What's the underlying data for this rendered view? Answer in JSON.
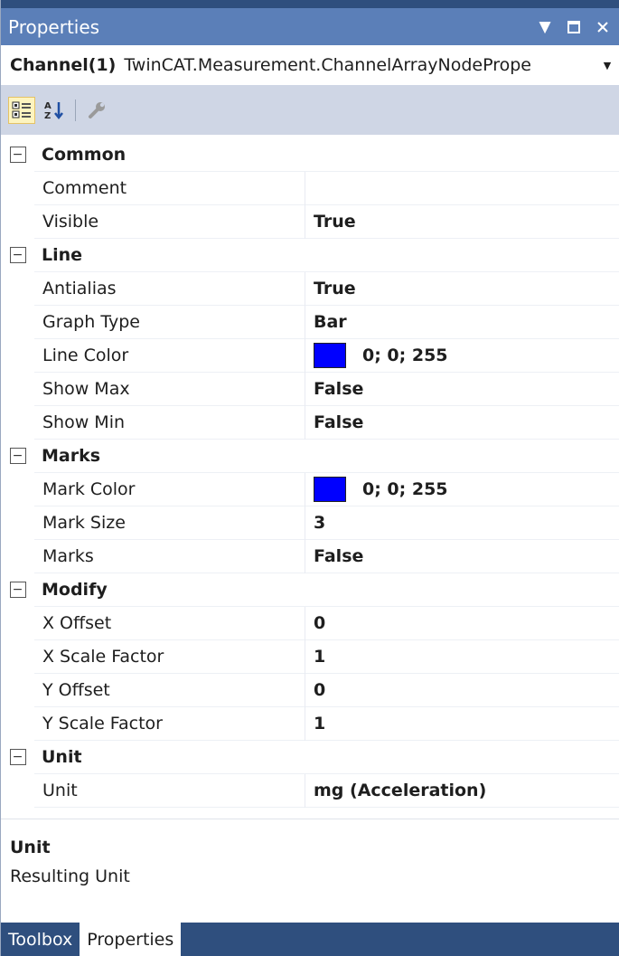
{
  "window": {
    "title": "Properties",
    "controls": {
      "dropdown_icon": "chevron-down-icon",
      "maximize_icon": "maximize-icon",
      "close_icon": "close-icon"
    }
  },
  "object_selector": {
    "name": "Channel(1)",
    "type": "TwinCAT.Measurement.ChannelArrayNodePrope"
  },
  "toolbar": {
    "buttons": [
      {
        "name": "categorized-icon",
        "active": true
      },
      {
        "name": "alphabetical-icon",
        "active": false
      },
      {
        "name": "property-pages-icon",
        "active": false
      }
    ]
  },
  "grid": {
    "categories": [
      {
        "label": "Common",
        "rows": [
          {
            "name": "Comment",
            "value": ""
          },
          {
            "name": "Visible",
            "value": "True"
          }
        ]
      },
      {
        "label": "Line",
        "rows": [
          {
            "name": "Antialias",
            "value": "True"
          },
          {
            "name": "Graph Type",
            "value": "Bar"
          },
          {
            "name": "Line Color",
            "value": "0; 0; 255",
            "swatch": "#0000ff"
          },
          {
            "name": "Show Max",
            "value": "False"
          },
          {
            "name": "Show Min",
            "value": "False"
          }
        ]
      },
      {
        "label": "Marks",
        "rows": [
          {
            "name": "Mark Color",
            "value": "0; 0; 255",
            "swatch": "#0000ff"
          },
          {
            "name": "Mark Size",
            "value": "3"
          },
          {
            "name": "Marks",
            "value": "False"
          }
        ]
      },
      {
        "label": "Modify",
        "rows": [
          {
            "name": "X Offset",
            "value": "0"
          },
          {
            "name": "X Scale Factor",
            "value": "1"
          },
          {
            "name": "Y Offset",
            "value": "0"
          },
          {
            "name": "Y Scale Factor",
            "value": "1"
          }
        ]
      },
      {
        "label": "Unit",
        "rows": [
          {
            "name": "Unit",
            "value": "mg (Acceleration)"
          }
        ]
      }
    ]
  },
  "description": {
    "title": "Unit",
    "text": "Resulting Unit"
  },
  "tabs": [
    {
      "label": "Toolbox",
      "active": false
    },
    {
      "label": "Properties",
      "active": true
    }
  ],
  "colors": {
    "titlebar": "#5b7fb8",
    "tabstrip": "#2f4f7e",
    "toolbar": "#cfd6e5",
    "swatch_blue": "#0000ff"
  }
}
